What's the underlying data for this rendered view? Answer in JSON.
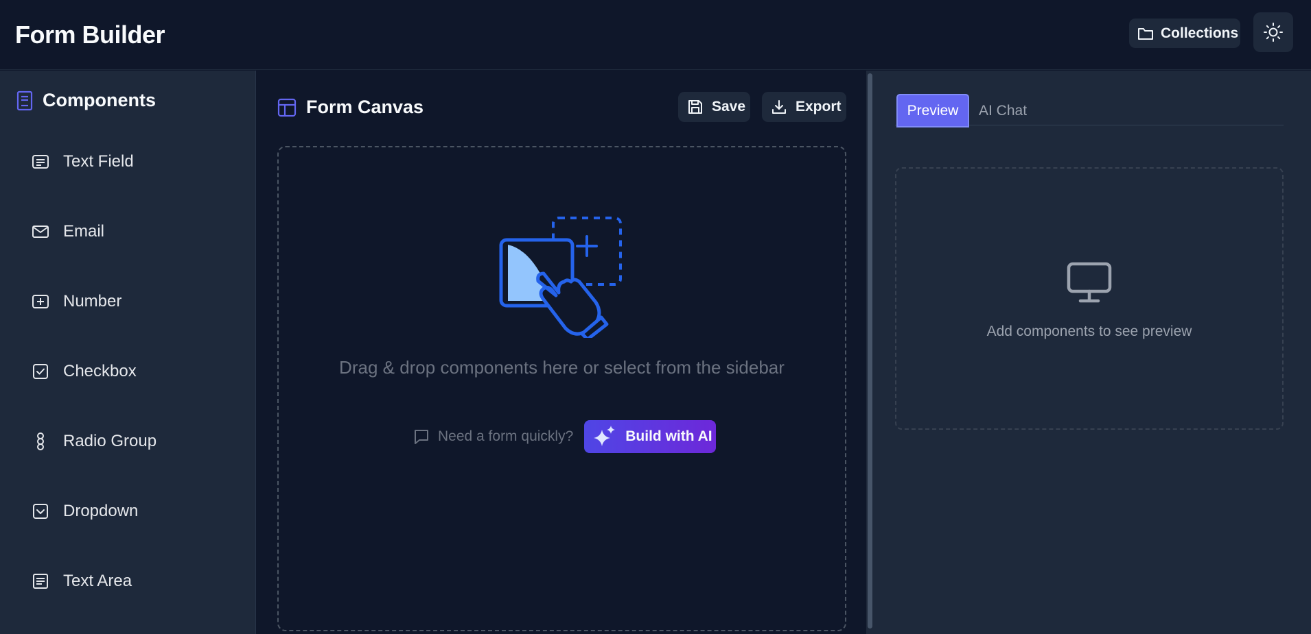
{
  "header": {
    "title": "Form Builder",
    "collections_label": "Collections",
    "theme_icon": "sun-icon"
  },
  "sidebar": {
    "title": "Components",
    "items": [
      {
        "label": "Text Field",
        "icon": "text-field-icon"
      },
      {
        "label": "Email",
        "icon": "mail-icon"
      },
      {
        "label": "Number",
        "icon": "number-plus-icon"
      },
      {
        "label": "Checkbox",
        "icon": "checkbox-icon"
      },
      {
        "label": "Radio Group",
        "icon": "radio-group-icon"
      },
      {
        "label": "Dropdown",
        "icon": "dropdown-icon"
      },
      {
        "label": "Text Area",
        "icon": "text-area-icon"
      }
    ]
  },
  "canvas": {
    "title": "Form Canvas",
    "save_label": "Save",
    "export_label": "Export",
    "drop_text": "Drag & drop components here or select from the sidebar",
    "quick_text": "Need a form quickly?",
    "ai_button_label": "Build with AI"
  },
  "preview": {
    "tabs": [
      {
        "label": "Preview",
        "active": true
      },
      {
        "label": "AI Chat",
        "active": false
      }
    ],
    "empty_text": "Add components to see preview"
  },
  "colors": {
    "accent": "#6366f1",
    "background": "#0f172a",
    "panel": "#1e293b",
    "illustration": "#2563eb"
  }
}
